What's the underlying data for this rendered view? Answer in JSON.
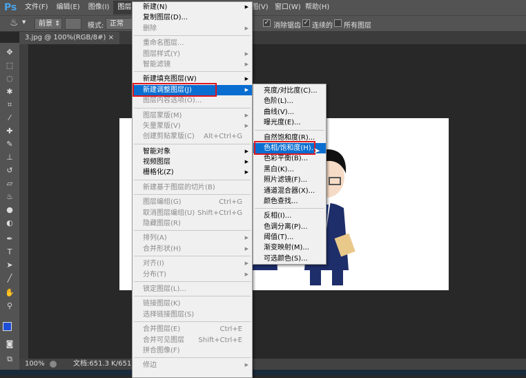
{
  "menubar": {
    "logo": "Ps",
    "items": [
      "文件(F)",
      "编辑(E)",
      "图像(I)",
      "图层(L)",
      "视图(V)",
      "窗口(W)",
      "帮助(H)"
    ]
  },
  "options": {
    "tool_icon": "paint-bucket-icon",
    "fill_source": "前景",
    "mode_label": "模式:",
    "mode_value": "正常",
    "anti_alias": {
      "label": "消除锯齿",
      "checked": true
    },
    "contiguous": {
      "label": "连续的",
      "checked": true
    },
    "all_layers": {
      "label": "所有图层",
      "checked": false
    }
  },
  "tab": {
    "title": "3.jpg @ 100%(RGB/8#)",
    "close": "×"
  },
  "status": {
    "zoom": "100%",
    "doc": "文档:651.3 K/651.3K"
  },
  "colors": {
    "foreground": "#1f4fd8",
    "background": "#ffffff",
    "highlight": "#0a6ed1",
    "annotation": "#e0161d"
  },
  "layer_menu": [
    {
      "label": "新建(N)",
      "sub": true
    },
    {
      "label": "复制图层(D)..."
    },
    {
      "label": "删除",
      "dis": true,
      "sub": true
    },
    {
      "sep": true
    },
    {
      "label": "重命名图层...",
      "dis": true
    },
    {
      "label": "图层样式(Y)",
      "dis": true,
      "sub": true
    },
    {
      "label": "智能滤镜",
      "dis": true,
      "sub": true
    },
    {
      "sep": true
    },
    {
      "label": "新建填充图层(W)",
      "sub": true
    },
    {
      "label": "新建调整图层(J)",
      "sub": true,
      "hl": true
    },
    {
      "label": "图层内容选项(O)...",
      "dis": true
    },
    {
      "sep": true
    },
    {
      "label": "图层蒙版(M)",
      "dis": true,
      "sub": true
    },
    {
      "label": "矢量蒙版(V)",
      "dis": true,
      "sub": true
    },
    {
      "label": "创建剪贴蒙版(C)",
      "dis": true,
      "sc": "Alt+Ctrl+G"
    },
    {
      "sep": true
    },
    {
      "label": "智能对象",
      "sub": true
    },
    {
      "label": "视频图层",
      "sub": true
    },
    {
      "label": "栅格化(Z)",
      "sub": true
    },
    {
      "sep": true
    },
    {
      "label": "新建基于图层的切片(B)",
      "dis": true
    },
    {
      "sep": true
    },
    {
      "label": "图层编组(G)",
      "dis": true,
      "sc": "Ctrl+G"
    },
    {
      "label": "取消图层编组(U)",
      "dis": true,
      "sc": "Shift+Ctrl+G"
    },
    {
      "label": "隐藏图层(R)",
      "dis": true
    },
    {
      "sep": true
    },
    {
      "label": "排列(A)",
      "dis": true,
      "sub": true
    },
    {
      "label": "合并形状(H)",
      "dis": true,
      "sub": true
    },
    {
      "sep": true
    },
    {
      "label": "对齐(I)",
      "dis": true,
      "sub": true
    },
    {
      "label": "分布(T)",
      "dis": true,
      "sub": true
    },
    {
      "sep": true
    },
    {
      "label": "锁定图层(L)...",
      "dis": true
    },
    {
      "sep": true
    },
    {
      "label": "链接图层(K)",
      "dis": true
    },
    {
      "label": "选择链接图层(S)",
      "dis": true
    },
    {
      "sep": true
    },
    {
      "label": "合并图层(E)",
      "dis": true,
      "sc": "Ctrl+E"
    },
    {
      "label": "合并可见图层",
      "dis": true,
      "sc": "Shift+Ctrl+E"
    },
    {
      "label": "拼合图像(F)",
      "dis": true
    },
    {
      "sep": true
    },
    {
      "label": "修边",
      "dis": true,
      "sub": true
    }
  ],
  "adjust_menu": [
    {
      "label": "亮度/对比度(C)..."
    },
    {
      "label": "色阶(L)..."
    },
    {
      "label": "曲线(V)..."
    },
    {
      "label": "曝光度(E)..."
    },
    {
      "sep": true
    },
    {
      "label": "自然饱和度(R)..."
    },
    {
      "label": "色相/饱和度(H)...",
      "hl": true
    },
    {
      "label": "色彩平衡(B)..."
    },
    {
      "label": "黑白(K)..."
    },
    {
      "label": "照片滤镜(F)..."
    },
    {
      "label": "通道混合器(X)..."
    },
    {
      "label": "颜色查找..."
    },
    {
      "sep": true
    },
    {
      "label": "反相(I)..."
    },
    {
      "label": "色调分离(P)..."
    },
    {
      "label": "阈值(T)..."
    },
    {
      "label": "渐变映射(M)..."
    },
    {
      "label": "可选颜色(S)..."
    }
  ]
}
